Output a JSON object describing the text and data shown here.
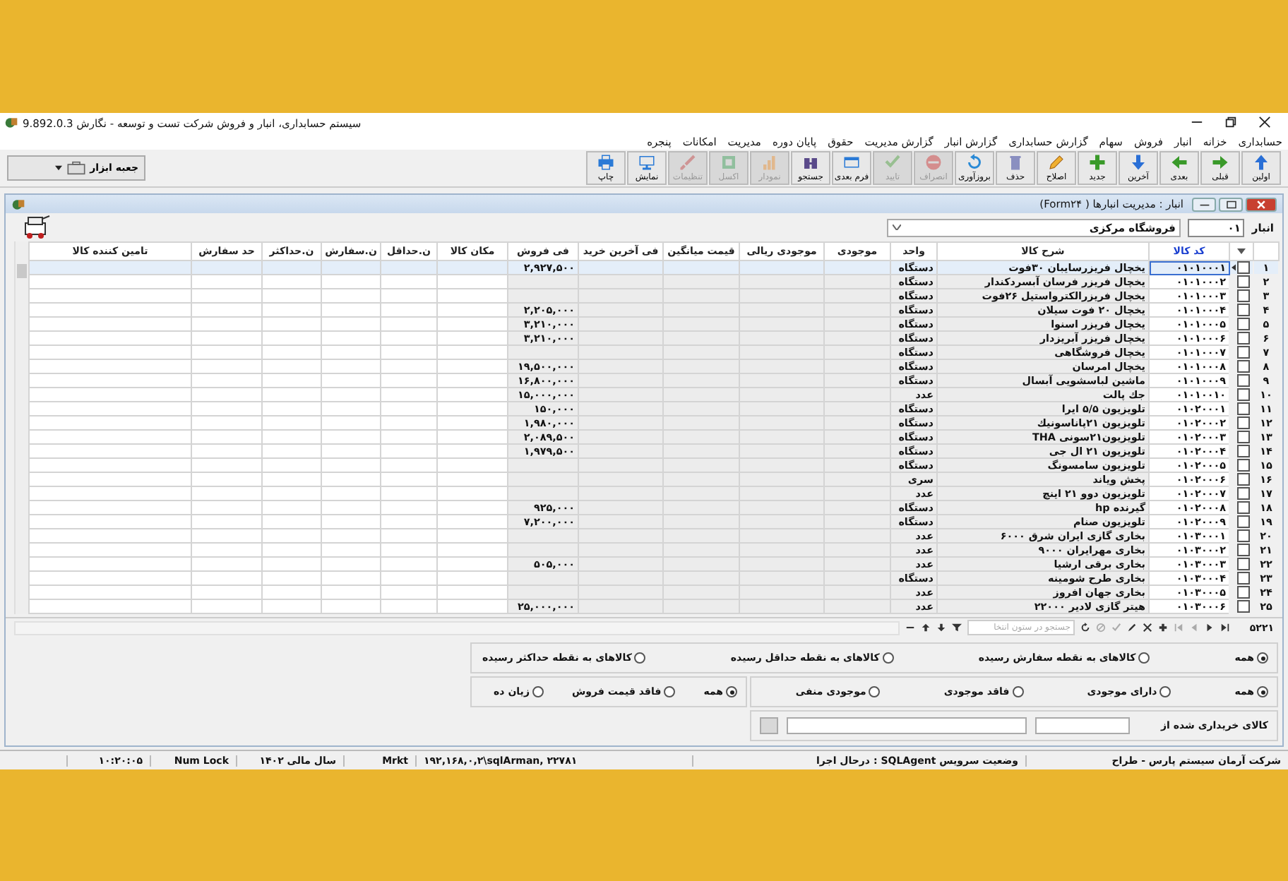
{
  "window": {
    "title": "سیستم حسابداری، انبار و فروش شرکت تست و توسعه - نگارش 9.892.0.3"
  },
  "menu": [
    "حسابداری",
    "خزانه",
    "انبار",
    "فروش",
    "سهام",
    "گزارش حسابداری",
    "گزارش انبار",
    "گزارش مدیریت",
    "حقوق",
    "پایان دوره",
    "مدیریت",
    "امکانات",
    "پنجره"
  ],
  "toolbar": {
    "buttons": [
      {
        "label": "اولین",
        "disabled": false
      },
      {
        "label": "قبلی",
        "disabled": false
      },
      {
        "label": "بعدی",
        "disabled": false
      },
      {
        "label": "آخرین",
        "disabled": false
      },
      {
        "label": "جدید",
        "disabled": false
      },
      {
        "label": "اصلاح",
        "disabled": false
      },
      {
        "label": "حذف",
        "disabled": false
      },
      {
        "label": "بروزآوری",
        "disabled": false
      },
      {
        "label": "انصراف",
        "disabled": true
      },
      {
        "label": "تایید",
        "disabled": true
      },
      {
        "label": "فرم بعدی",
        "disabled": false
      },
      {
        "label": "جستجو",
        "disabled": false
      },
      {
        "label": "نمودار",
        "disabled": true
      },
      {
        "label": "اکسل",
        "disabled": true
      },
      {
        "label": "تنظیمات",
        "disabled": true
      },
      {
        "label": "نمایش",
        "disabled": false
      },
      {
        "label": "چاپ",
        "disabled": false
      }
    ],
    "toolbox": "جعبه ابزار"
  },
  "form": {
    "title": "انبار : مدیریت انبارها ( Form۲۴)",
    "warehouse_label": "انبار",
    "warehouse_code": "۰۱",
    "warehouse_name": "فروشگاه مرکزی"
  },
  "table": {
    "columns": [
      {
        "label": "کد کالا",
        "selected": true,
        "read_only": false
      },
      {
        "label": "شرح کالا",
        "selected": false,
        "read_only": true
      },
      {
        "label": "واحد",
        "selected": false,
        "read_only": true
      },
      {
        "label": "موجودی",
        "selected": false,
        "read_only": true
      },
      {
        "label": "موجودی ریالی",
        "selected": false,
        "read_only": true
      },
      {
        "label": "قیمت میانگین",
        "selected": false,
        "read_only": true
      },
      {
        "label": "فی آخرین خرید",
        "selected": false,
        "read_only": true
      },
      {
        "label": "فی فروش",
        "selected": false,
        "read_only": true
      },
      {
        "label": "مکان کالا",
        "selected": false,
        "read_only": false
      },
      {
        "label": "ن.حداقل",
        "selected": false,
        "read_only": false
      },
      {
        "label": "ن.سفارش",
        "selected": false,
        "read_only": false
      },
      {
        "label": "ن.حداکثر",
        "selected": false,
        "read_only": false
      },
      {
        "label": "حد سفارش",
        "selected": false,
        "read_only": false
      },
      {
        "label": "تامین کننده کالا",
        "selected": false,
        "read_only": false
      }
    ],
    "rows": [
      {
        "number": "۱",
        "checked": false,
        "selected": true,
        "code": "۰۱۰۱۰۰۰۱",
        "description": "یخچال فریزرسایبان ۳۰فوت",
        "unit": "دستگاه",
        "sale_price": "۲,۹۲۷,۵۰۰"
      },
      {
        "number": "۲",
        "checked": false,
        "selected": false,
        "code": "۰۱۰۱۰۰۰۲",
        "description": "یخچال فریزر فرسان آبسردکندار",
        "unit": "دستگاه"
      },
      {
        "number": "۳",
        "checked": false,
        "selected": false,
        "code": "۰۱۰۱۰۰۰۳",
        "description": "یخچال فریزرالکترواستیل ۲۶فوت",
        "unit": "دستگاه"
      },
      {
        "number": "۴",
        "checked": false,
        "selected": false,
        "code": "۰۱۰۱۰۰۰۴",
        "description": "یخچال ۲۰ فوت سیلان",
        "unit": "دستگاه",
        "sale_price": "۲,۲۰۵,۰۰۰"
      },
      {
        "number": "۵",
        "checked": false,
        "selected": false,
        "code": "۰۱۰۱۰۰۰۵",
        "description": "یخچال فریزر اسنوا",
        "unit": "دستگاه",
        "sale_price": "۳,۲۱۰,۰۰۰"
      },
      {
        "number": "۶",
        "checked": false,
        "selected": false,
        "code": "۰۱۰۱۰۰۰۶",
        "description": "یخچال فریزر آبریزدار",
        "unit": "دستگاه",
        "sale_price": "۳,۲۱۰,۰۰۰"
      },
      {
        "number": "۷",
        "checked": false,
        "selected": false,
        "code": "۰۱۰۱۰۰۰۷",
        "description": "یخچال فروشگاهی",
        "unit": "دستگاه"
      },
      {
        "number": "۸",
        "checked": false,
        "selected": false,
        "code": "۰۱۰۱۰۰۰۸",
        "description": "یخچال امرسان",
        "unit": "دستگاه",
        "sale_price": "۱۹,۵۰۰,۰۰۰"
      },
      {
        "number": "۹",
        "checked": false,
        "selected": false,
        "code": "۰۱۰۱۰۰۰۹",
        "description": "ماشین لباسشویی آبسال",
        "unit": "دستگاه",
        "sale_price": "۱۶,۸۰۰,۰۰۰"
      },
      {
        "number": "۱۰",
        "checked": false,
        "selected": false,
        "code": "۰۱۰۱۰۰۱۰",
        "description": "جك پالت",
        "unit": "عدد",
        "sale_price": "۱۵,۰۰۰,۰۰۰"
      },
      {
        "number": "۱۱",
        "checked": false,
        "selected": false,
        "code": "۰۱۰۲۰۰۰۱",
        "description": "تلویزیون ۵/۵ ایرا",
        "unit": "دستگاه",
        "sale_price": "۱۵۰,۰۰۰"
      },
      {
        "number": "۱۲",
        "checked": false,
        "selected": false,
        "code": "۰۱۰۲۰۰۰۲",
        "description": "تلویزیون ۲۱پاناسونیك",
        "unit": "دستگاه",
        "sale_price": "۱,۹۸۰,۰۰۰"
      },
      {
        "number": "۱۳",
        "checked": false,
        "selected": false,
        "code": "۰۱۰۲۰۰۰۳",
        "description": "تلویزیون۲۱سونی THA",
        "unit": "دستگاه",
        "sale_price": "۲,۰۸۹,۵۰۰"
      },
      {
        "number": "۱۴",
        "checked": false,
        "selected": false,
        "code": "۰۱۰۲۰۰۰۴",
        "description": "تلویزیون ۲۱ ال جی",
        "unit": "دستگاه",
        "sale_price": "۱,۹۷۹,۵۰۰"
      },
      {
        "number": "۱۵",
        "checked": false,
        "selected": false,
        "code": "۰۱۰۲۰۰۰۵",
        "description": "تلویزیون سامسونگ",
        "unit": "دستگاه"
      },
      {
        "number": "۱۶",
        "checked": false,
        "selected": false,
        "code": "۰۱۰۲۰۰۰۶",
        "description": "پخش ویاند",
        "unit": "سری"
      },
      {
        "number": "۱۷",
        "checked": false,
        "selected": false,
        "code": "۰۱۰۲۰۰۰۷",
        "description": "تلویزیون دوو ۲۱ اینچ",
        "unit": "عدد"
      },
      {
        "number": "۱۸",
        "checked": false,
        "selected": false,
        "code": "۰۱۰۲۰۰۰۸",
        "description": "گیرنده hp",
        "unit": "دستگاه",
        "sale_price": "۹۲۵,۰۰۰"
      },
      {
        "number": "۱۹",
        "checked": false,
        "selected": false,
        "code": "۰۱۰۲۰۰۰۹",
        "description": "تلویزیون صنام",
        "unit": "دستگاه",
        "sale_price": "۷,۲۰۰,۰۰۰"
      },
      {
        "number": "۲۰",
        "checked": false,
        "selected": false,
        "code": "۰۱۰۳۰۰۰۱",
        "description": "بخاری گازی ایران شرق ۶۰۰۰",
        "unit": "عدد"
      },
      {
        "number": "۲۱",
        "checked": false,
        "selected": false,
        "code": "۰۱۰۳۰۰۰۲",
        "description": "بخاری مهرایران ۹۰۰۰",
        "unit": "عدد"
      },
      {
        "number": "۲۲",
        "checked": false,
        "selected": false,
        "code": "۰۱۰۳۰۰۰۳",
        "description": "بخاری برقی ارشیا",
        "unit": "عدد",
        "sale_price": "۵۰۵,۰۰۰"
      },
      {
        "number": "۲۳",
        "checked": false,
        "selected": false,
        "code": "۰۱۰۳۰۰۰۴",
        "description": "بخاری طرح شومینه",
        "unit": "دستگاه"
      },
      {
        "number": "۲۴",
        "checked": false,
        "selected": false,
        "code": "۰۱۰۳۰۰۰۵",
        "description": "بخاری جهان افروز",
        "unit": "عدد"
      },
      {
        "number": "۲۵",
        "checked": false,
        "selected": false,
        "code": "۰۱۰۳۰۰۰۶",
        "description": "هیتر گازی لادیر ۲۲۰۰۰",
        "unit": "عدد",
        "sale_price": "۲۵,۰۰۰,۰۰۰"
      }
    ]
  },
  "navigator": {
    "record_count": "۵۲۲۱",
    "search_placeholder": "جستجو در ستون انتخا"
  },
  "filters": {
    "reorder": [
      {
        "label": "همه",
        "selected": true
      },
      {
        "label": "کالاهای به نقطه سفارش رسیده",
        "selected": false
      },
      {
        "label": "کالاهای به نقطه حداقل رسیده",
        "selected": false
      },
      {
        "label": "کالاهای به نقطه حداکثر رسیده",
        "selected": false
      }
    ],
    "stock": [
      {
        "label": "همه",
        "selected": true
      },
      {
        "label": "دارای موجودی",
        "selected": false
      },
      {
        "label": "فاقد موجودی",
        "selected": false
      },
      {
        "label": "موجودی منفی",
        "selected": false
      }
    ],
    "price": [
      {
        "label": "همه",
        "selected": true
      },
      {
        "label": "فاقد قیمت فروش",
        "selected": false
      },
      {
        "label": "زیان ده",
        "selected": false
      }
    ],
    "purchased_from_label": "کالای خریداری شده از"
  },
  "status_bar": [
    "شرکت آرمان سیستم پارس  - طراح",
    "وضعیت سرویس SQLAgent : درحال اجرا",
    "۱۹۲,۱۶۸,۰,۲\\sqlArman, ۲۲۷۸۱",
    "Mrkt",
    "سال مالی ۱۴۰۲",
    "Num Lock",
    "۱۰:۲۰:۰۵"
  ]
}
